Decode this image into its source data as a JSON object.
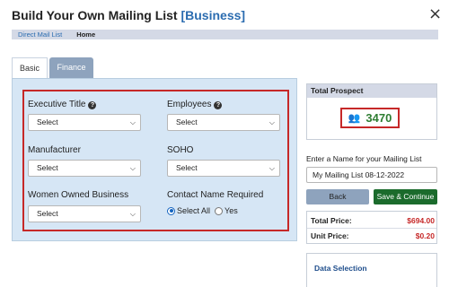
{
  "header": {
    "title": "Build Your Own Mailing List",
    "title_accent": "[Business]",
    "close": "×"
  },
  "breadcrumb": {
    "link": "Direct Mail List",
    "current": "Home"
  },
  "tabs": [
    {
      "label": "Basic",
      "active": true
    },
    {
      "label": "Finance",
      "active": false
    }
  ],
  "filters": {
    "executive_title": {
      "label": "Executive Title",
      "value": "Select",
      "help": "?"
    },
    "employees": {
      "label": "Employees",
      "value": "Select",
      "help": "?"
    },
    "manufacturer": {
      "label": "Manufacturer",
      "value": "Select"
    },
    "soho": {
      "label": "SOHO",
      "value": "Select"
    },
    "women_owned": {
      "label": "Women Owned Business",
      "value": "Select"
    },
    "contact_name": {
      "label": "Contact Name Required",
      "options": [
        "Select All",
        "Yes"
      ],
      "selected": "Select All"
    }
  },
  "sidebar": {
    "total_prospect": {
      "header": "Total Prospect",
      "count": "3470",
      "icon": "people-icon"
    },
    "list_name": {
      "label": "Enter a Name for your Mailing List",
      "value": "My Mailing List 08-12-2022"
    },
    "buttons": {
      "back": "Back",
      "save": "Save & Continue"
    },
    "pricing": {
      "total_label": "Total Price:",
      "total_value": "$694.00",
      "unit_label": "Unit Price:",
      "unit_value": "$0.20"
    },
    "data_selection": {
      "title": "Data Selection"
    }
  },
  "colors": {
    "accent": "#2b6cb0",
    "highlight": "#c62828",
    "count": "#2e7d32",
    "save_button": "#1b6b2c",
    "panel": "#d6e6f5"
  }
}
